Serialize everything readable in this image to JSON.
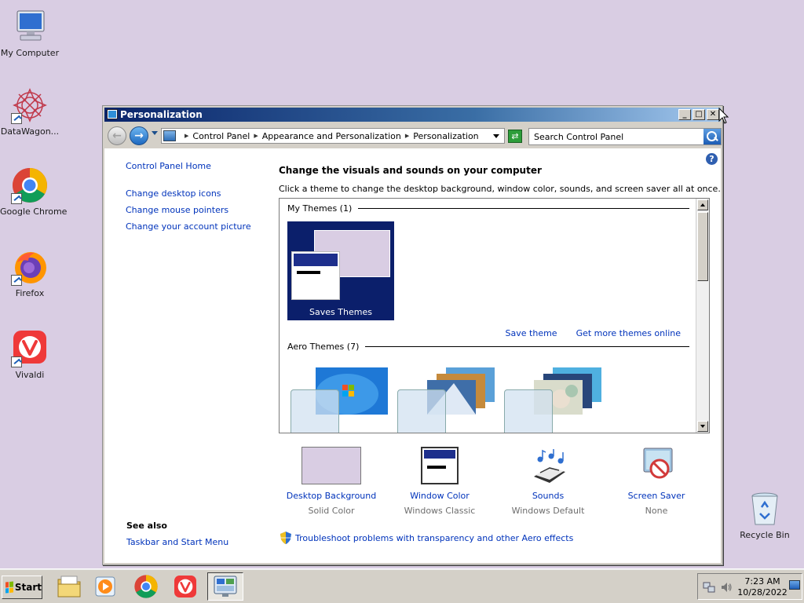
{
  "desktop": {
    "icons": [
      {
        "label": "My Computer",
        "icon": "my-computer-icon"
      },
      {
        "label": "DataWagon...",
        "icon": "datawagon-icon"
      },
      {
        "label": "Google Chrome",
        "icon": "chrome-icon"
      },
      {
        "label": "Firefox",
        "icon": "firefox-icon"
      },
      {
        "label": "Vivaldi",
        "icon": "vivaldi-icon"
      },
      {
        "label": "Recycle Bin",
        "icon": "recycle-bin-icon"
      }
    ],
    "background_color": "#d9cde3"
  },
  "window": {
    "title": "Personalization",
    "controls": {
      "minimize": "_",
      "maximize": "□",
      "close": "✕"
    }
  },
  "address": {
    "crumbs": [
      "Control Panel",
      "Appearance and Personalization",
      "Personalization"
    ],
    "search_placeholder": "Search Control Panel"
  },
  "left_pane": {
    "home": "Control Panel Home",
    "tasks": [
      "Change desktop icons",
      "Change mouse pointers",
      "Change your account picture"
    ],
    "see_also_title": "See also",
    "see_also_links": [
      "Taskbar and Start Menu"
    ]
  },
  "main": {
    "title": "Change the visuals and sounds on your computer",
    "subtitle": "Click a theme to change the desktop background, window color, sounds, and screen saver all at once.",
    "my_themes_heading": "My Themes (1)",
    "selected_theme": "Saves Themes",
    "save_theme": "Save theme",
    "more_themes": "Get more themes online",
    "aero_heading": "Aero Themes (7)",
    "settings": [
      {
        "name": "Desktop Background",
        "value": "Solid Color"
      },
      {
        "name": "Window Color",
        "value": "Windows Classic"
      },
      {
        "name": "Sounds",
        "value": "Windows Default"
      },
      {
        "name": "Screen Saver",
        "value": "None"
      }
    ],
    "troubleshoot": "Troubleshoot problems with transparency and other Aero effects"
  },
  "taskbar": {
    "start_label": "Start",
    "time": "7:23 AM",
    "date": "10/28/2022",
    "pinned": [
      "file-explorer-icon",
      "media-player-icon",
      "chrome-icon",
      "vivaldi-icon",
      "control-panel-icon"
    ]
  },
  "colors": {
    "accent_link": "#0033bb",
    "title_gradient_start": "#0a246a",
    "selected_theme_bg": "#0b1f6b"
  }
}
